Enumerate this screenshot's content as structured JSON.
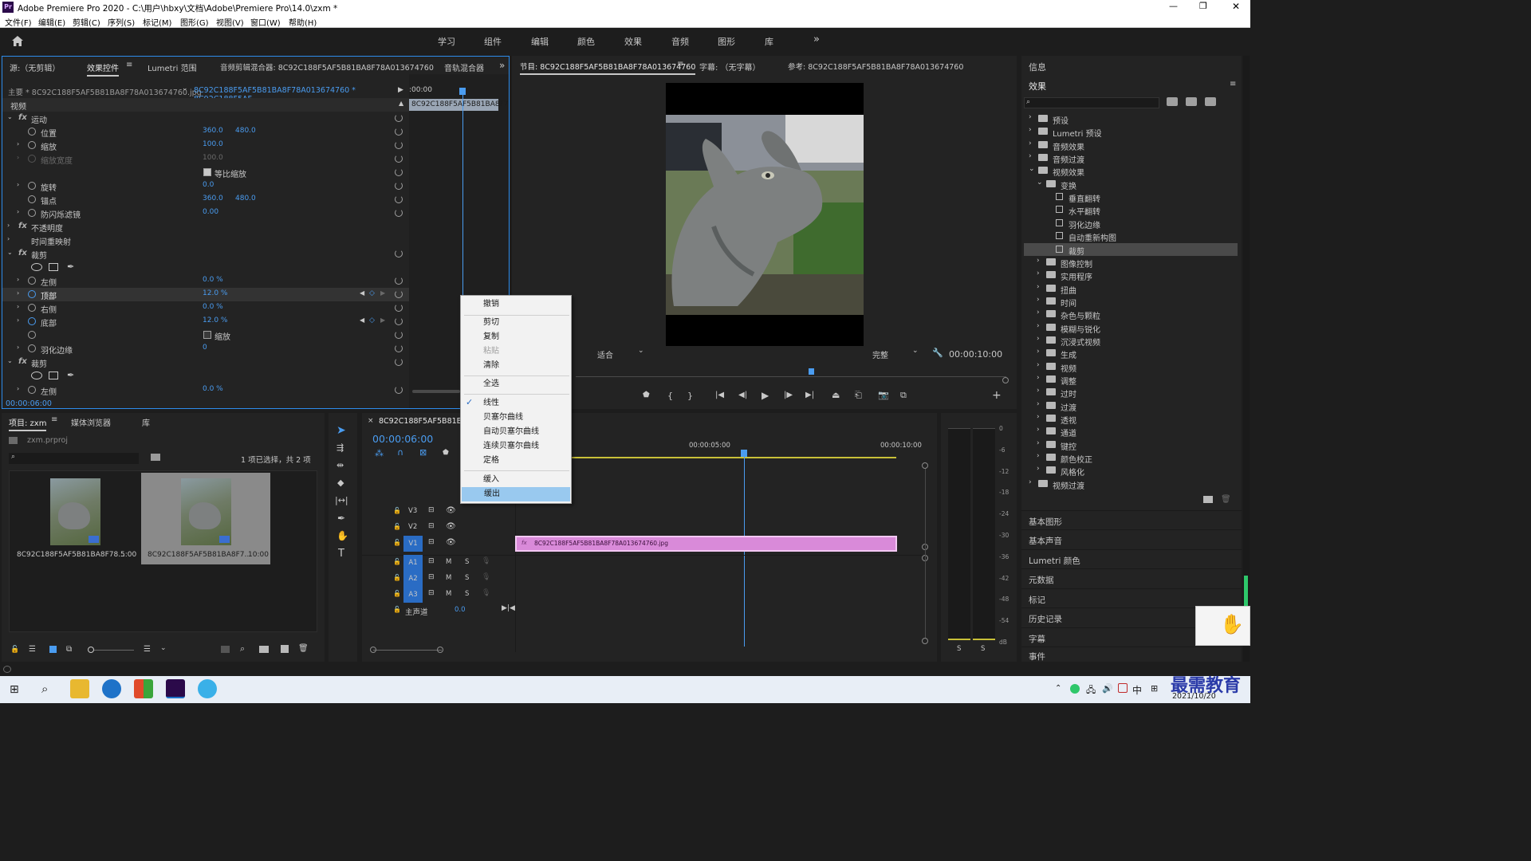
{
  "window": {
    "title": "Adobe Premiere Pro 2020 - C:\\用户\\hbxy\\文档\\Adobe\\Premiere Pro\\14.0\\zxm *"
  },
  "menubar": [
    "文件(F)",
    "编辑(E)",
    "剪辑(C)",
    "序列(S)",
    "标记(M)",
    "图形(G)",
    "视图(V)",
    "窗口(W)",
    "帮助(H)"
  ],
  "workspaces": [
    "学习",
    "组件",
    "编辑",
    "颜色",
    "效果",
    "音频",
    "图形",
    "库"
  ],
  "source_tabs": {
    "source": "源:（无剪辑）",
    "effect_controls": "效果控件",
    "lumetri": "Lumetri 范围",
    "mixer": "音频剪辑混合器: 8C92C188F5AF5B81BA8F78A013674760",
    "track_mixer": "音轨混合器"
  },
  "ec": {
    "master": "主要 * 8C92C188F5AF5B81BA8F78A013674760.jpg",
    "sequence": "8C92C188F5AF5B81BA8F78A013674760 * 8C92C188F5AF...",
    "time_start": ":00:00",
    "clip_label": "8C92C188F5AF5B81BA8F7",
    "video": "视频",
    "motion": "运动",
    "position": "位置",
    "pos_x": "360.0",
    "pos_y": "480.0",
    "scale": "缩放",
    "scale_v": "100.0",
    "scale_w": "缩放宽度",
    "scale_w_v": "100.0",
    "uniform": "等比缩放",
    "rotation": "旋转",
    "rotation_v": "0.0",
    "anchor": "锚点",
    "anc_x": "360.0",
    "anc_y": "480.0",
    "flicker": "防闪烁滤镜",
    "flicker_v": "0.00",
    "opacity": "不透明度",
    "remap": "时间重映射",
    "crop": "裁剪",
    "left": "左侧",
    "left_v": "0.0 %",
    "top": "顶部",
    "top_v": "12.0 %",
    "right": "右侧",
    "right_v": "0.0 %",
    "bottom": "底部",
    "bottom_v": "12.0 %",
    "zoom": "缩放",
    "feather": "羽化边缘",
    "feather_v": "0",
    "crop2": "裁剪",
    "left2": "左侧",
    "left2_v": "0.0 %",
    "current_time": "00:00:06:00"
  },
  "context_menu": {
    "items": [
      "撤销",
      "剪切",
      "复制",
      "粘贴",
      "清除",
      "全选",
      "线性",
      "贝塞尔曲线",
      "自动贝塞尔曲线",
      "连续贝塞尔曲线",
      "定格",
      "缓入",
      "缓出"
    ],
    "checked": "线性",
    "highlighted": "缓出"
  },
  "program": {
    "tab": "节目: 8C92C188F5AF5B81BA8F78A013674760",
    "captions": "字幕: （无字幕）",
    "reference": "参考: 8C92C188F5AF5B81BA8F78A013674760",
    "fit": "适合",
    "quality": "完整",
    "duration": "00:00:10:00"
  },
  "project": {
    "tabs": [
      "项目: zxm",
      "媒体浏览器",
      "库"
    ],
    "file": "zxm.prproj",
    "selection": "1 项已选择，共 2 项",
    "items": [
      {
        "name": "8C92C188F5AF5B81BA8F78...",
        "dur": "5:00"
      },
      {
        "name": "8C92C188F5AF5B81BA8F7...",
        "dur": "10:00"
      }
    ]
  },
  "timeline": {
    "tab": "8C92C188F5AF5B81BA8",
    "timecode": "00:00:06:00",
    "ruler": [
      "00:00:05:00",
      "00:00:10:00"
    ],
    "tracks_v": [
      "V3",
      "V2",
      "V1"
    ],
    "tracks_a": [
      "A1",
      "A2",
      "A3"
    ],
    "master": "主声道",
    "master_v": "0.0",
    "clip": "8C92C188F5AF5B81BA8F78A013674760.jpg"
  },
  "meter": {
    "scale": [
      "0",
      "-6",
      "-12",
      "-18",
      "-24",
      "-30",
      "-36",
      "-42",
      "-48",
      "-54",
      "dB"
    ],
    "s1": "S",
    "s2": "S"
  },
  "effects": {
    "info": "信息",
    "title": "效果",
    "tree": [
      {
        "label": "预设",
        "level": 0,
        "type": "folder"
      },
      {
        "label": "Lumetri 预设",
        "level": 0,
        "type": "folder"
      },
      {
        "label": "音频效果",
        "level": 0,
        "type": "folder"
      },
      {
        "label": "音频过渡",
        "level": 0,
        "type": "folder"
      },
      {
        "label": "视频效果",
        "level": 0,
        "type": "folder",
        "open": true
      },
      {
        "label": "变换",
        "level": 1,
        "type": "folder",
        "open": true
      },
      {
        "label": "垂直翻转",
        "level": 2,
        "type": "fx"
      },
      {
        "label": "水平翻转",
        "level": 2,
        "type": "fx"
      },
      {
        "label": "羽化边缘",
        "level": 2,
        "type": "fx"
      },
      {
        "label": "自动重新构图",
        "level": 2,
        "type": "fx"
      },
      {
        "label": "裁剪",
        "level": 2,
        "type": "fx",
        "selected": true
      },
      {
        "label": "图像控制",
        "level": 1,
        "type": "folder"
      },
      {
        "label": "实用程序",
        "level": 1,
        "type": "folder"
      },
      {
        "label": "扭曲",
        "level": 1,
        "type": "folder"
      },
      {
        "label": "时间",
        "level": 1,
        "type": "folder"
      },
      {
        "label": "杂色与颗粒",
        "level": 1,
        "type": "folder"
      },
      {
        "label": "模糊与锐化",
        "level": 1,
        "type": "folder"
      },
      {
        "label": "沉浸式视频",
        "level": 1,
        "type": "folder"
      },
      {
        "label": "生成",
        "level": 1,
        "type": "folder"
      },
      {
        "label": "视频",
        "level": 1,
        "type": "folder"
      },
      {
        "label": "调整",
        "level": 1,
        "type": "folder"
      },
      {
        "label": "过时",
        "level": 1,
        "type": "folder"
      },
      {
        "label": "过渡",
        "level": 1,
        "type": "folder"
      },
      {
        "label": "透视",
        "level": 1,
        "type": "folder"
      },
      {
        "label": "通道",
        "level": 1,
        "type": "folder"
      },
      {
        "label": "键控",
        "level": 1,
        "type": "folder"
      },
      {
        "label": "颜色校正",
        "level": 1,
        "type": "folder"
      },
      {
        "label": "风格化",
        "level": 1,
        "type": "folder"
      },
      {
        "label": "视频过渡",
        "level": 0,
        "type": "folder"
      }
    ],
    "sections": [
      "基本图形",
      "基本声音",
      "Lumetri 颜色",
      "元数据",
      "标记",
      "历史记录",
      "字幕",
      "事件"
    ]
  },
  "taskbar": {
    "ime": "中",
    "date": "2021/10/20",
    "watermark": "最需教育"
  }
}
